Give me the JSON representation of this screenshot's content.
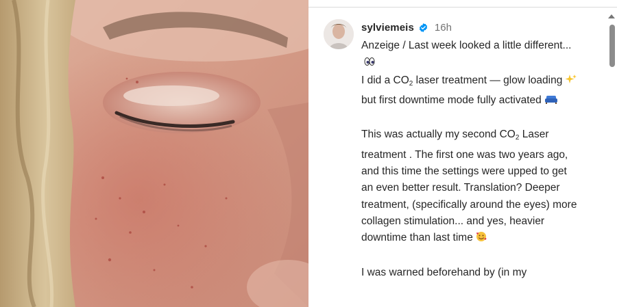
{
  "post": {
    "username": "sylviemeis",
    "verified": true,
    "time": "16h",
    "caption": {
      "line1": "Anzeige / Last week looked a little different...",
      "line2a": "I did a CO",
      "line2b": "laser treatment — glow loading",
      "line2c": "but first downtime mode fully activated",
      "para2a": "This was actually my second CO",
      "para2b": "Laser treatment . The first one was two years ago, and this time the settings were upped to get an even better result. Translation? Deeper treatment, (specifically around the eyes) more collagen stimulation... and yes, heavier downtime than last time",
      "para3": "I was warned beforehand by (in my",
      "subscript": "2"
    }
  },
  "icons": {
    "verified": "verified-badge-icon",
    "eyes": "eyes-emoji",
    "sparkles": "sparkles-emoji",
    "couch": "couch-emoji",
    "smiling_hearts": "smiling-face-with-hearts-emoji"
  },
  "colors": {
    "text": "#262626",
    "muted": "#737373",
    "verified_blue": "#0095f6"
  }
}
